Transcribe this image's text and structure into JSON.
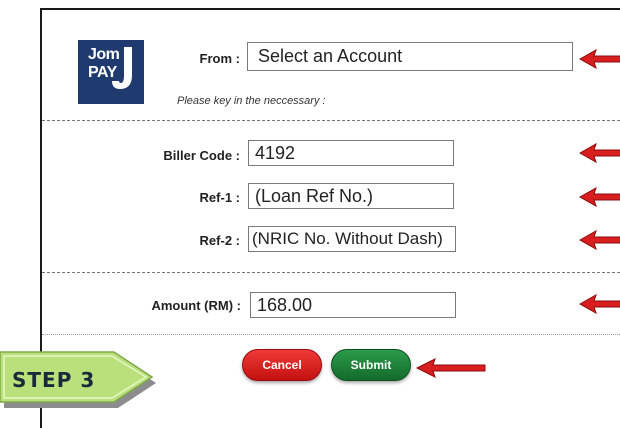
{
  "logo": {
    "line1": "Jom",
    "line2": "PAY",
    "brand_color": "#1f3a6e"
  },
  "form": {
    "from_label": "From :",
    "from_value": "Select an Account",
    "hint": "Please key in the neccessary :",
    "biller_code_label": "Biller Code :",
    "biller_code_value": "4192",
    "ref1_label": "Ref-1 :",
    "ref1_value": "(Loan Ref No.)",
    "ref2_label": "Ref-2 :",
    "ref2_value": "(NRIC No. Without Dash)",
    "amount_label": "Amount (RM) :",
    "amount_value": "168.00"
  },
  "buttons": {
    "cancel": "Cancel",
    "submit": "Submit"
  },
  "step": {
    "label": "STEP 3"
  },
  "icons": {
    "pointer_arrow": "red-arrow-icon"
  },
  "colors": {
    "arrow": "#d81e1e",
    "cancel": "#e02020",
    "submit": "#1f8a3e",
    "step_bg": "#b9e07a"
  }
}
